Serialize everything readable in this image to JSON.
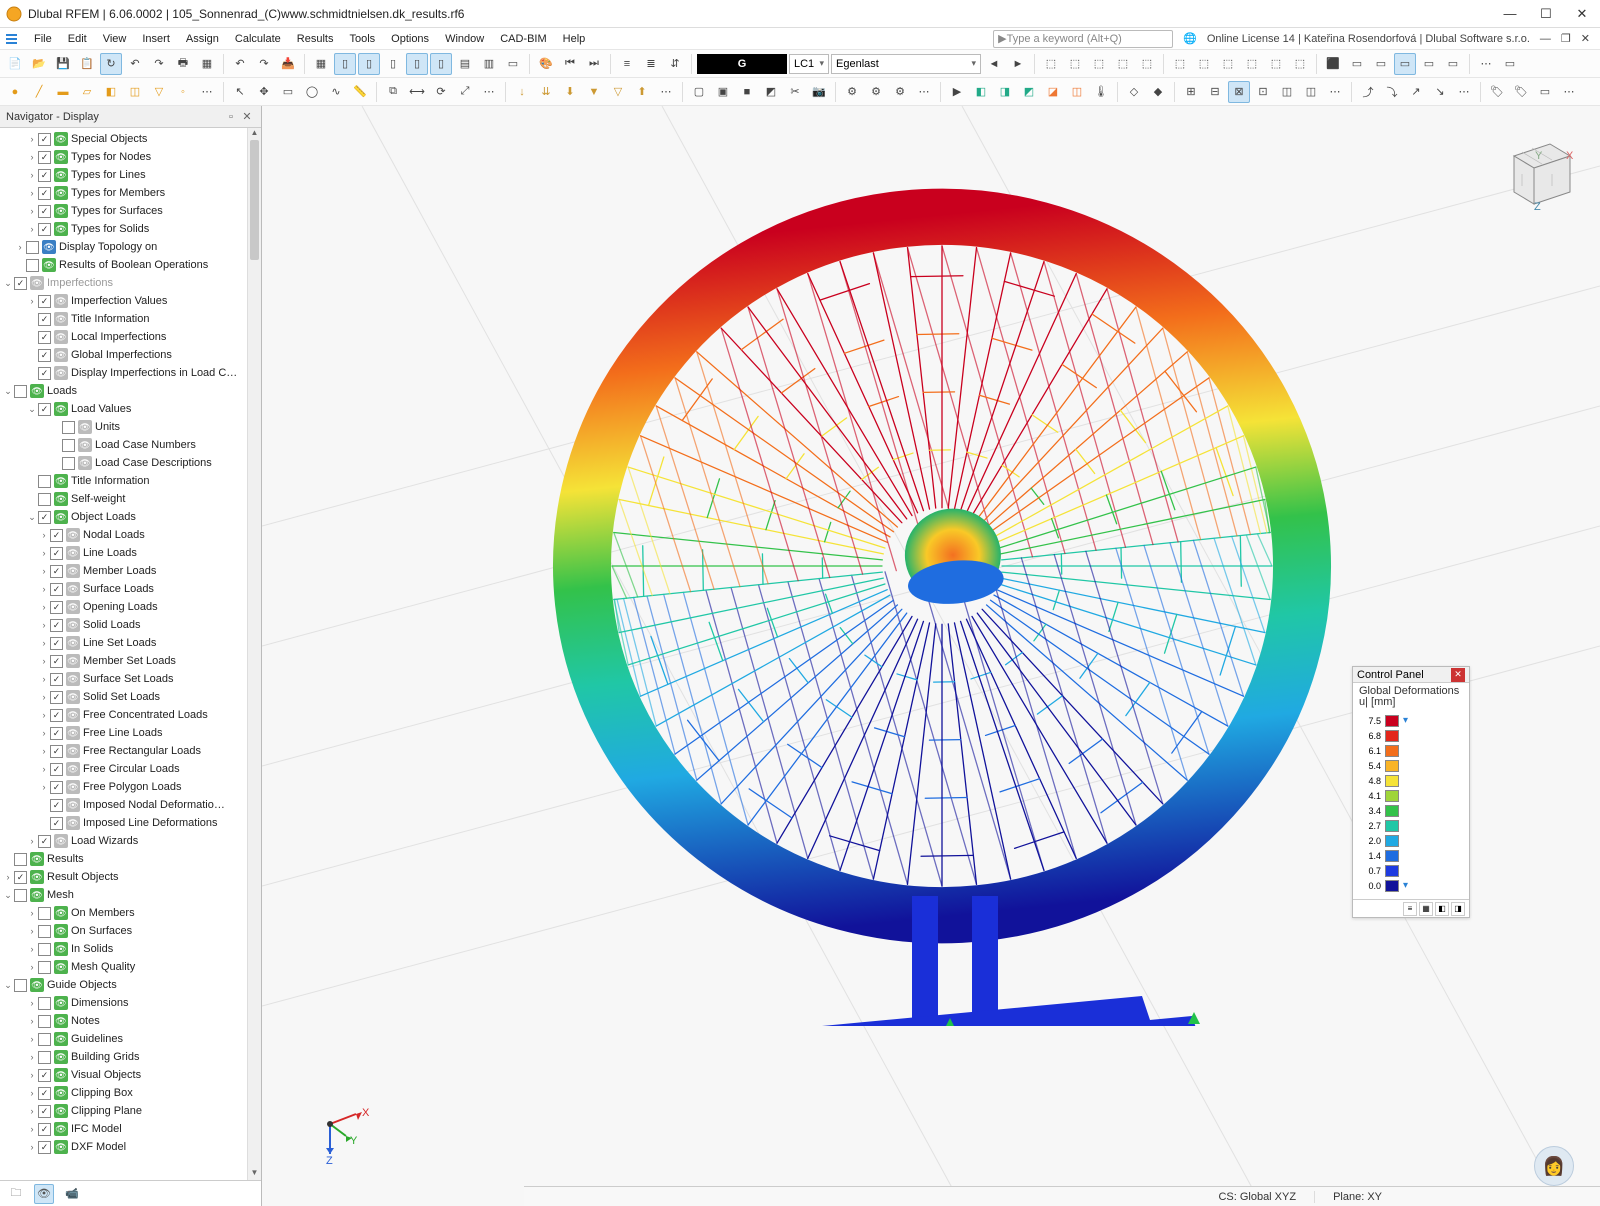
{
  "title": "Dlubal RFEM | 6.06.0002 | 105_Sonnenrad_(C)www.schmidtnielsen.dk_results.rf6",
  "menu": [
    "File",
    "Edit",
    "View",
    "Insert",
    "Assign",
    "Calculate",
    "Results",
    "Tools",
    "Options",
    "Window",
    "CAD-BIM",
    "Help"
  ],
  "search_placeholder": "Type a keyword (Alt+Q)",
  "license": "Online License 14 | Kateřina Rosendorfová | Dlubal Software s.r.o.",
  "toolbar1": {
    "combo_g": "G",
    "combo_lc": "LC1",
    "combo_lcname": "Egenlast"
  },
  "nav_title": "Navigator - Display",
  "tree": [
    {
      "ind": 2,
      "tw": "›",
      "chk": true,
      "eye": "green",
      "label": "Special Objects"
    },
    {
      "ind": 2,
      "tw": "›",
      "chk": true,
      "eye": "green",
      "label": "Types for Nodes"
    },
    {
      "ind": 2,
      "tw": "›",
      "chk": true,
      "eye": "green",
      "label": "Types for Lines"
    },
    {
      "ind": 2,
      "tw": "›",
      "chk": true,
      "eye": "green",
      "label": "Types for Members"
    },
    {
      "ind": 2,
      "tw": "›",
      "chk": true,
      "eye": "green",
      "label": "Types for Surfaces"
    },
    {
      "ind": 2,
      "tw": "›",
      "chk": true,
      "eye": "green",
      "label": "Types for Solids"
    },
    {
      "ind": 1,
      "tw": "›",
      "chk": false,
      "eye": "blue",
      "label": "Display Topology on"
    },
    {
      "ind": 1,
      "tw": "",
      "chk": false,
      "eye": "green",
      "label": "Results of Boolean Operations"
    },
    {
      "ind": 0,
      "tw": "⌄",
      "chk": true,
      "eye": "gray",
      "label": "Imperfections",
      "gray": true
    },
    {
      "ind": 2,
      "tw": "›",
      "chk": true,
      "eye": "gray",
      "label": "Imperfection Values"
    },
    {
      "ind": 2,
      "tw": "",
      "chk": true,
      "eye": "gray",
      "label": "Title Information"
    },
    {
      "ind": 2,
      "tw": "",
      "chk": true,
      "eye": "gray",
      "label": "Local Imperfections"
    },
    {
      "ind": 2,
      "tw": "",
      "chk": true,
      "eye": "gray",
      "label": "Global Imperfections"
    },
    {
      "ind": 2,
      "tw": "",
      "chk": true,
      "eye": "gray",
      "label": "Display Imperfections in Load C…"
    },
    {
      "ind": 0,
      "tw": "⌄",
      "chk": false,
      "eye": "green",
      "label": "Loads"
    },
    {
      "ind": 2,
      "tw": "⌄",
      "chk": true,
      "eye": "green",
      "label": "Load Values"
    },
    {
      "ind": 4,
      "tw": "",
      "chk": false,
      "eye": "gray",
      "label": "Units"
    },
    {
      "ind": 4,
      "tw": "",
      "chk": false,
      "eye": "gray",
      "label": "Load Case Numbers"
    },
    {
      "ind": 4,
      "tw": "",
      "chk": false,
      "eye": "gray",
      "label": "Load Case Descriptions"
    },
    {
      "ind": 2,
      "tw": "",
      "chk": false,
      "eye": "green",
      "label": "Title Information"
    },
    {
      "ind": 2,
      "tw": "",
      "chk": false,
      "eye": "green",
      "label": "Self-weight"
    },
    {
      "ind": 2,
      "tw": "⌄",
      "chk": true,
      "eye": "green",
      "label": "Object Loads"
    },
    {
      "ind": 3,
      "tw": "›",
      "chk": true,
      "eye": "gray",
      "label": "Nodal Loads"
    },
    {
      "ind": 3,
      "tw": "›",
      "chk": true,
      "eye": "gray",
      "label": "Line Loads"
    },
    {
      "ind": 3,
      "tw": "›",
      "chk": true,
      "eye": "gray",
      "label": "Member Loads"
    },
    {
      "ind": 3,
      "tw": "›",
      "chk": true,
      "eye": "gray",
      "label": "Surface Loads"
    },
    {
      "ind": 3,
      "tw": "›",
      "chk": true,
      "eye": "gray",
      "label": "Opening Loads"
    },
    {
      "ind": 3,
      "tw": "›",
      "chk": true,
      "eye": "gray",
      "label": "Solid Loads"
    },
    {
      "ind": 3,
      "tw": "›",
      "chk": true,
      "eye": "gray",
      "label": "Line Set Loads"
    },
    {
      "ind": 3,
      "tw": "›",
      "chk": true,
      "eye": "gray",
      "label": "Member Set Loads"
    },
    {
      "ind": 3,
      "tw": "›",
      "chk": true,
      "eye": "gray",
      "label": "Surface Set Loads"
    },
    {
      "ind": 3,
      "tw": "›",
      "chk": true,
      "eye": "gray",
      "label": "Solid Set Loads"
    },
    {
      "ind": 3,
      "tw": "›",
      "chk": true,
      "eye": "gray",
      "label": "Free Concentrated Loads"
    },
    {
      "ind": 3,
      "tw": "›",
      "chk": true,
      "eye": "gray",
      "label": "Free Line Loads"
    },
    {
      "ind": 3,
      "tw": "›",
      "chk": true,
      "eye": "gray",
      "label": "Free Rectangular Loads"
    },
    {
      "ind": 3,
      "tw": "›",
      "chk": true,
      "eye": "gray",
      "label": "Free Circular Loads"
    },
    {
      "ind": 3,
      "tw": "›",
      "chk": true,
      "eye": "gray",
      "label": "Free Polygon Loads"
    },
    {
      "ind": 3,
      "tw": "",
      "chk": true,
      "eye": "gray",
      "label": "Imposed Nodal Deformatio…"
    },
    {
      "ind": 3,
      "tw": "",
      "chk": true,
      "eye": "gray",
      "label": "Imposed Line Deformations"
    },
    {
      "ind": 2,
      "tw": "›",
      "chk": true,
      "eye": "gray",
      "label": "Load Wizards"
    },
    {
      "ind": 0,
      "tw": "",
      "chk": false,
      "eye": "green",
      "label": "Results"
    },
    {
      "ind": 0,
      "tw": "›",
      "chk": true,
      "eye": "green",
      "label": "Result Objects"
    },
    {
      "ind": 0,
      "tw": "⌄",
      "chk": false,
      "eye": "green",
      "label": "Mesh"
    },
    {
      "ind": 2,
      "tw": "›",
      "chk": false,
      "eye": "green",
      "label": "On Members"
    },
    {
      "ind": 2,
      "tw": "›",
      "chk": false,
      "eye": "green",
      "label": "On Surfaces"
    },
    {
      "ind": 2,
      "tw": "›",
      "chk": false,
      "eye": "green",
      "label": "In Solids"
    },
    {
      "ind": 2,
      "tw": "›",
      "chk": false,
      "eye": "green",
      "label": "Mesh Quality"
    },
    {
      "ind": 0,
      "tw": "⌄",
      "chk": false,
      "eye": "green",
      "label": "Guide Objects"
    },
    {
      "ind": 2,
      "tw": "›",
      "chk": false,
      "eye": "green",
      "label": "Dimensions"
    },
    {
      "ind": 2,
      "tw": "›",
      "chk": false,
      "eye": "green",
      "label": "Notes"
    },
    {
      "ind": 2,
      "tw": "›",
      "chk": false,
      "eye": "green",
      "label": "Guidelines"
    },
    {
      "ind": 2,
      "tw": "›",
      "chk": false,
      "eye": "green",
      "label": "Building Grids"
    },
    {
      "ind": 2,
      "tw": "›",
      "chk": true,
      "eye": "green",
      "label": "Visual Objects"
    },
    {
      "ind": 2,
      "tw": "›",
      "chk": true,
      "eye": "green",
      "label": "Clipping Box"
    },
    {
      "ind": 2,
      "tw": "›",
      "chk": true,
      "eye": "green",
      "label": "Clipping Plane"
    },
    {
      "ind": 2,
      "tw": "›",
      "chk": true,
      "eye": "green",
      "label": "IFC Model"
    },
    {
      "ind": 2,
      "tw": "›",
      "chk": true,
      "eye": "green",
      "label": "DXF Model"
    }
  ],
  "control_panel": {
    "title": "Control Panel",
    "subtitle1": "Global Deformations",
    "subtitle2": "u| [mm]",
    "legend": [
      {
        "v": "7.5",
        "c": "#c9001e"
      },
      {
        "v": "6.8",
        "c": "#e3261b"
      },
      {
        "v": "6.1",
        "c": "#f36e1b"
      },
      {
        "v": "5.4",
        "c": "#f9b427"
      },
      {
        "v": "4.8",
        "c": "#f5e337"
      },
      {
        "v": "4.1",
        "c": "#9fd53a"
      },
      {
        "v": "3.4",
        "c": "#33c24a"
      },
      {
        "v": "2.7",
        "c": "#20c7a6"
      },
      {
        "v": "2.0",
        "c": "#20a9e2"
      },
      {
        "v": "1.4",
        "c": "#1f6de0"
      },
      {
        "v": "0.7",
        "c": "#1e3be0"
      },
      {
        "v": "0.0",
        "c": "#11129a"
      }
    ]
  },
  "status": {
    "cs": "CS: Global XYZ",
    "plane": "Plane: XY"
  },
  "axes": {
    "x": "X",
    "y": "Y",
    "z": "Z"
  }
}
